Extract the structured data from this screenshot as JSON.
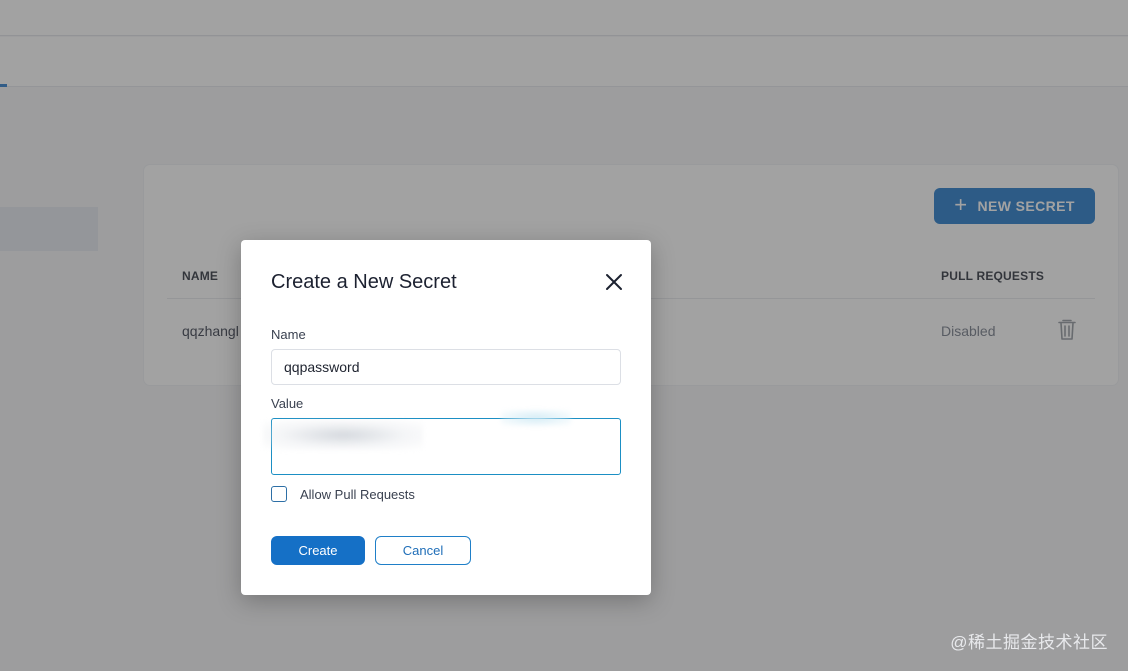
{
  "page": {
    "secrets_table": {
      "new_secret_button": {
        "icon": "plus-icon",
        "label": "NEW SECRET"
      },
      "columns": {
        "name": "NAME",
        "pull_requests": "PULL REQUESTS"
      },
      "rows": [
        {
          "name": "qqzhangl",
          "pull_requests": "Disabled",
          "delete_icon": "trash-icon"
        }
      ]
    }
  },
  "modal": {
    "title": "Create a New Secret",
    "close_icon": "close-icon",
    "name_label": "Name",
    "name_value": "qqpassword",
    "value_label": "Value",
    "value_value": "",
    "allow_pull_requests_label": "Allow Pull Requests",
    "allow_pull_requests_checked": false,
    "create_label": "Create",
    "cancel_label": "Cancel"
  },
  "watermark": "@稀土掘金技术社区",
  "colors": {
    "primary": "#1570c6",
    "focus_border": "#1b8fc4",
    "overlay": "rgba(70,70,70,0.5)"
  }
}
